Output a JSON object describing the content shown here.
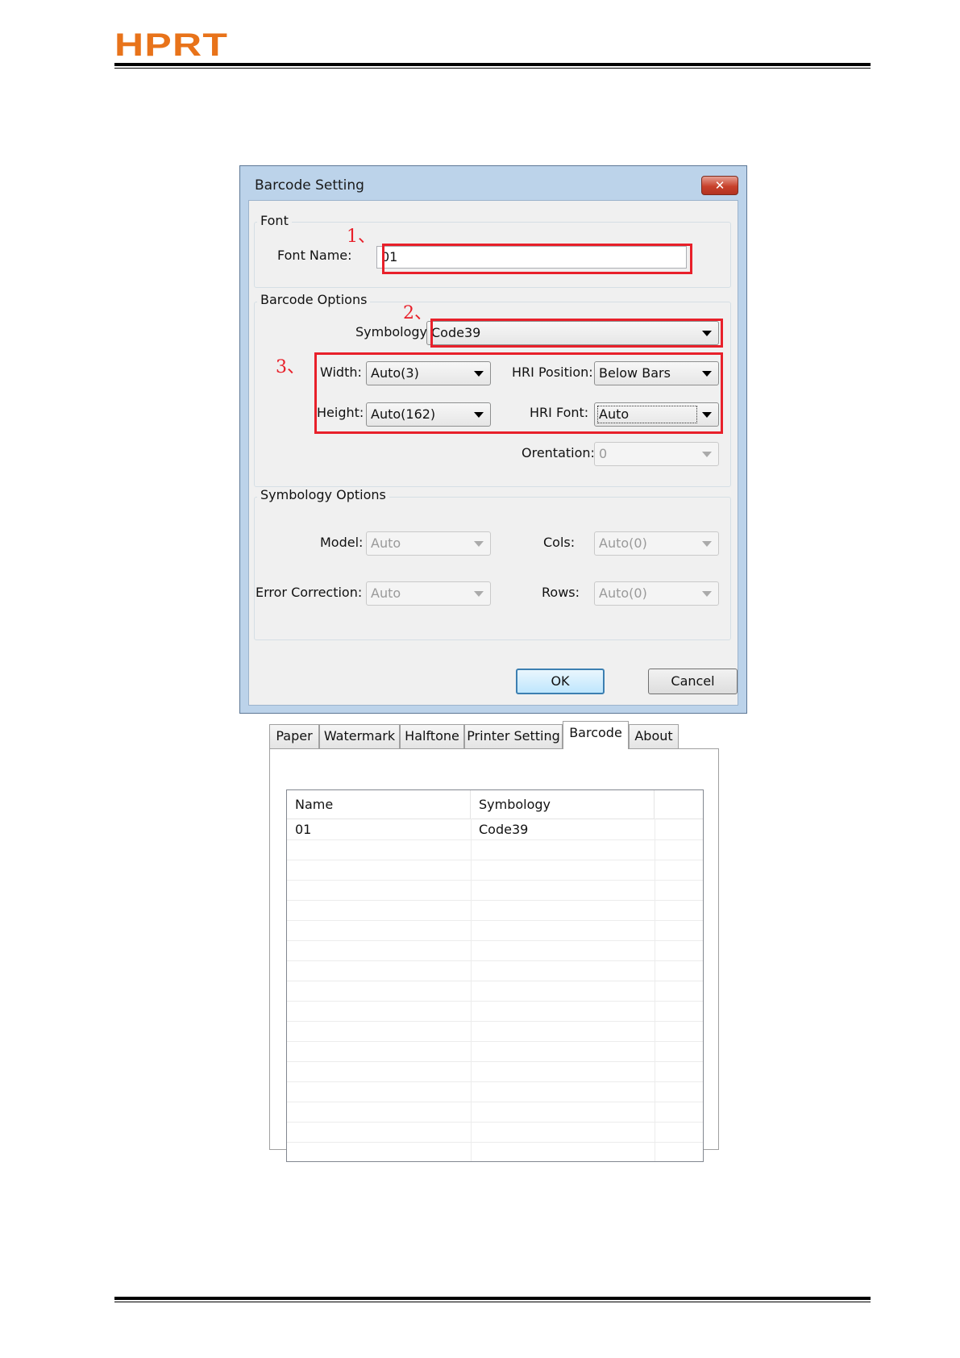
{
  "header": {
    "logo_text": "HPRT",
    "brand_color": "#e8731a"
  },
  "dialog": {
    "title": "Barcode Setting",
    "close_glyph": "✕",
    "font_group": {
      "label": "Font",
      "font_name_label": "Font Name:",
      "font_name_value": "01"
    },
    "barcode_options": {
      "label": "Barcode Options",
      "symbology_label": "Symbology:",
      "symbology_value": "Code39",
      "width_label": "Width:",
      "width_value": "Auto(3)",
      "height_label": "Height:",
      "height_value": "Auto(162)",
      "hri_position_label": "HRI Position:",
      "hri_position_value": "Below Bars",
      "hri_font_label": "HRI Font:",
      "hri_font_value": "Auto",
      "orientation_label": "Orentation:",
      "orientation_value": "0"
    },
    "symbology_options": {
      "label": "Symbology Options",
      "model_label": "Model:",
      "model_value": "Auto",
      "error_correction_label": "Error Correction:",
      "error_correction_value": "Auto",
      "cols_label": "Cols:",
      "cols_value": "Auto(0)",
      "rows_label": "Rows:",
      "rows_value": "Auto(0)"
    },
    "ok_label": "OK",
    "cancel_label": "Cancel"
  },
  "annotations": {
    "step1": "1、",
    "step2": "2、",
    "step3": "3、",
    "color": "#e8202a"
  },
  "property_sheet": {
    "tabs": [
      "Paper",
      "Watermark",
      "Halftone",
      "Printer Setting",
      "Barcode",
      "About"
    ],
    "active_tab": "Barcode",
    "list": {
      "columns": [
        "Name",
        "Symbology"
      ],
      "rows": [
        {
          "name": "01",
          "symbology": "Code39"
        }
      ]
    }
  }
}
